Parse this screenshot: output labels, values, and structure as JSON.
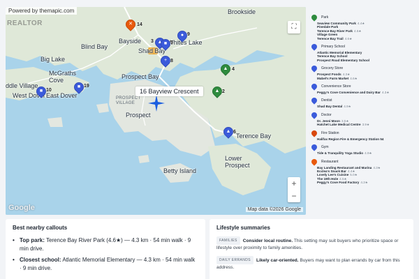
{
  "map": {
    "attribution": "Powered by themapic.com",
    "watermark": "REALTOR",
    "google_logo": "Google",
    "map_data": "Map data ©2026 Google",
    "address_label": "16 Bayview Crescent",
    "places": [
      {
        "id": "brookside",
        "label": "Brookside"
      },
      {
        "id": "blind-bay",
        "label": "Blind Bay"
      },
      {
        "id": "bayside",
        "label": "Bayside"
      },
      {
        "id": "shad-bay",
        "label": "Shad Bay"
      },
      {
        "id": "whites-lake",
        "label": "Whites Lake"
      },
      {
        "id": "big-lake",
        "label": "Big Lake"
      },
      {
        "id": "mcgraths-cove",
        "label": "McGraths\nCove"
      },
      {
        "id": "prospect-bay",
        "label": "Prospect Bay"
      },
      {
        "id": "middle-village",
        "label": "ddle Village"
      },
      {
        "id": "west-dover",
        "label": "West Dover"
      },
      {
        "id": "east-dover",
        "label": "East Dover"
      },
      {
        "id": "prospect-village",
        "label": "PROSPECT\nVILLAGE"
      },
      {
        "id": "prospect",
        "label": "Prospect"
      },
      {
        "id": "terence-bay",
        "label": "Terence Bay"
      },
      {
        "id": "lower-prospect",
        "label": "Lower\nProspect"
      },
      {
        "id": "betty-island",
        "label": "Betty Island"
      }
    ],
    "pin_numbers": [
      "14",
      "3",
      "5",
      "9",
      "8",
      "4",
      "2",
      "10",
      "19",
      "6"
    ]
  },
  "legend": [
    {
      "category": "Park",
      "color": "#2e8b3e",
      "items": [
        {
          "name": "Seaview Community Park",
          "rating": "4.4★"
        },
        {
          "name": "Pinedale Park",
          "rating": ""
        },
        {
          "name": "Terence Bay River Park",
          "rating": "4.6★"
        },
        {
          "name": "Village Green",
          "rating": ""
        },
        {
          "name": "Terence Bay Trail",
          "rating": "4.6★"
        }
      ]
    },
    {
      "category": "Primary School",
      "color": "#3b5bdb",
      "items": [
        {
          "name": "Atlantic Memorial Elementary",
          "rating": ""
        },
        {
          "name": "Terence Bay School",
          "rating": ""
        },
        {
          "name": "Prospect Road Elementary School",
          "rating": ""
        }
      ]
    },
    {
      "category": "Grocery Store",
      "color": "#3b5bdb",
      "items": [
        {
          "name": "Prospect Foods",
          "rating": "4.3★"
        },
        {
          "name": "Mabel's Farm Market",
          "rating": "4.6★"
        }
      ]
    },
    {
      "category": "Convenience Store",
      "color": "#3b5bdb",
      "items": [
        {
          "name": "Peggy's Cove Convenience and Dairy Bar",
          "rating": "4.3★"
        }
      ]
    },
    {
      "category": "Dentist",
      "color": "#3b5bdb",
      "items": [
        {
          "name": "Shad Bay Dental",
          "rating": "4.9★"
        }
      ]
    },
    {
      "category": "Doctor",
      "color": "#3b5bdb",
      "items": [
        {
          "name": "Dr. Jenni Moon",
          "rating": "3.5★"
        },
        {
          "name": "Hatchet Lake Medical Centre",
          "rating": "3.9★"
        }
      ]
    },
    {
      "category": "Fire Station",
      "color": "#d9480f",
      "items": [
        {
          "name": "Halifax Region Fire & Emergency Station 54",
          "rating": ""
        }
      ]
    },
    {
      "category": "Gym",
      "color": "#3b5bdb",
      "items": [
        {
          "name": "Tide & Tranquility Yoga Studio",
          "rating": "4.9★"
        }
      ]
    },
    {
      "category": "Restaurant",
      "color": "#e8590c",
      "items": [
        {
          "name": "Bay Landing Restaurant and Marina",
          "rating": "4.3★"
        },
        {
          "name": "Ecclea's Snack Bar",
          "rating": "4.4★"
        },
        {
          "name": "Lovely Lee's Cuisine",
          "rating": "5.0★"
        },
        {
          "name": "The 19th Hole",
          "rating": "4.5★"
        },
        {
          "name": "Peggy's Cove Food Factory",
          "rating": "4.3★"
        }
      ]
    }
  ],
  "callouts": {
    "title": "Best nearby callouts",
    "items": [
      {
        "label": "Top park:",
        "text": " Terence Bay River Park (4.6★) — 4.3 km · 54 min walk · 9 min drive."
      },
      {
        "label": "Closest school:",
        "text": " Atlantic Memorial Elementary — 4.3 km · 54 min walk · 9 min drive."
      }
    ]
  },
  "lifestyle": {
    "title": "Lifestyle summaries",
    "items": [
      {
        "tag": "FAMILIES",
        "headline": "Consider local routine.",
        "text": " This setting may suit buyers who prioritize space or lifestyle over proximity to family amenities."
      },
      {
        "tag": "DAILY ERRANDS",
        "headline": "Likely car-oriented.",
        "text": " Buyers may want to plan errands by car from this address."
      }
    ]
  }
}
